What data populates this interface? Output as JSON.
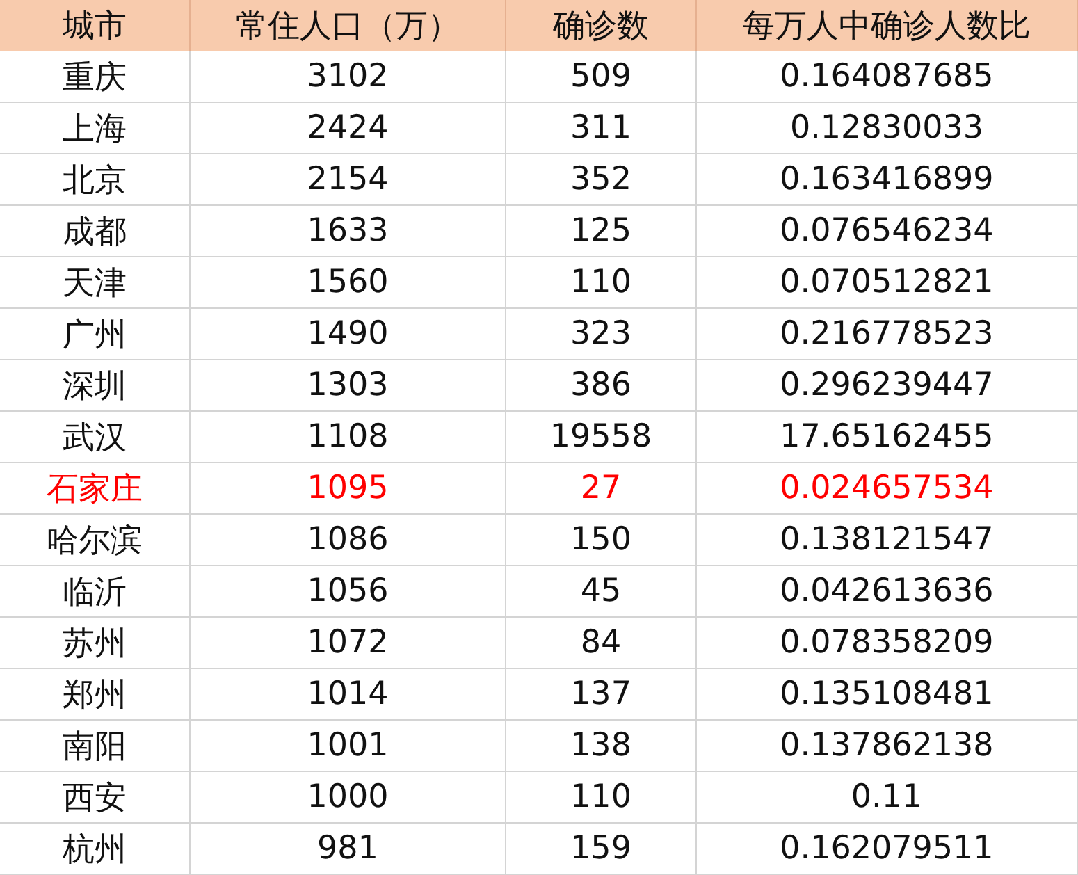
{
  "table": {
    "columns": [
      "城市",
      "常住人口（万）",
      "确诊数",
      "每万人中确诊人数比"
    ],
    "rows": [
      {
        "cells": [
          "重庆",
          "3102",
          "509",
          "0.164087685"
        ],
        "highlighted": false
      },
      {
        "cells": [
          "上海",
          "2424",
          "311",
          "0.12830033"
        ],
        "highlighted": false
      },
      {
        "cells": [
          "北京",
          "2154",
          "352",
          "0.163416899"
        ],
        "highlighted": false
      },
      {
        "cells": [
          "成都",
          "1633",
          "125",
          "0.076546234"
        ],
        "highlighted": false
      },
      {
        "cells": [
          "天津",
          "1560",
          "110",
          "0.070512821"
        ],
        "highlighted": false
      },
      {
        "cells": [
          "广州",
          "1490",
          "323",
          "0.216778523"
        ],
        "highlighted": false
      },
      {
        "cells": [
          "深圳",
          "1303",
          "386",
          "0.296239447"
        ],
        "highlighted": false
      },
      {
        "cells": [
          "武汉",
          "1108",
          "19558",
          "17.65162455"
        ],
        "highlighted": false
      },
      {
        "cells": [
          "石家庄",
          "1095",
          "27",
          "0.024657534"
        ],
        "highlighted": true
      },
      {
        "cells": [
          "哈尔滨",
          "1086",
          "150",
          "0.138121547"
        ],
        "highlighted": false
      },
      {
        "cells": [
          "临沂",
          "1056",
          "45",
          "0.042613636"
        ],
        "highlighted": false
      },
      {
        "cells": [
          "苏州",
          "1072",
          "84",
          "0.078358209"
        ],
        "highlighted": false
      },
      {
        "cells": [
          "郑州",
          "1014",
          "137",
          "0.135108481"
        ],
        "highlighted": false
      },
      {
        "cells": [
          "南阳",
          "1001",
          "138",
          "0.137862138"
        ],
        "highlighted": false
      },
      {
        "cells": [
          "西安",
          "1000",
          "110",
          "0.11"
        ],
        "highlighted": false
      },
      {
        "cells": [
          "杭州",
          "981",
          "159",
          "0.162079511"
        ],
        "highlighted": false
      }
    ]
  }
}
